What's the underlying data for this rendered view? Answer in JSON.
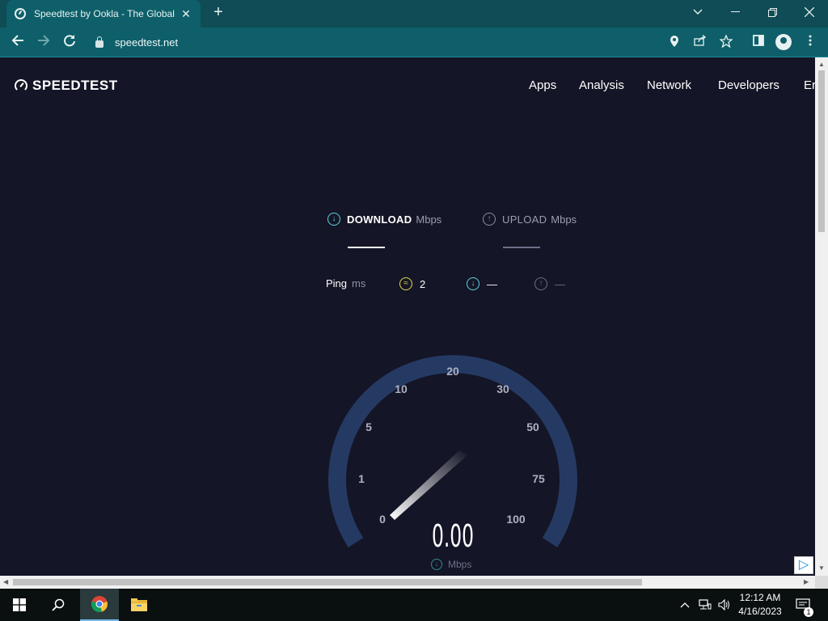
{
  "browser": {
    "tab_title": "Speedtest by Ookla - The Global",
    "tab_close": "✕",
    "new_tab": "+",
    "url": "speedtest.net",
    "window_controls": {
      "minimize": "—",
      "restore": "❐",
      "close": "✕",
      "tabsearch": "⌄"
    }
  },
  "site": {
    "logo": "SPEEDTEST",
    "nav": [
      "Apps",
      "Analysis",
      "Network",
      "Developers",
      "Er"
    ]
  },
  "metrics": {
    "download_label": "DOWNLOAD",
    "download_unit": "Mbps",
    "upload_label": "UPLOAD",
    "upload_unit": "Mbps"
  },
  "ping": {
    "label": "Ping",
    "unit": "ms",
    "jitter_value": "2",
    "download_value": "—",
    "upload_value": "—"
  },
  "gauge": {
    "ticks": [
      "0",
      "1",
      "5",
      "10",
      "20",
      "30",
      "50",
      "75",
      "100"
    ],
    "reading": "0.00",
    "reading_unit": "Mbps"
  },
  "colors": {
    "accent_download": "#5fd3e0",
    "accent_jitter": "#e4d74a",
    "background": "#141526",
    "gauge_arc": "#253a63"
  },
  "taskbar": {
    "time": "12:12 AM",
    "date": "4/16/2023",
    "notifications": "1"
  }
}
